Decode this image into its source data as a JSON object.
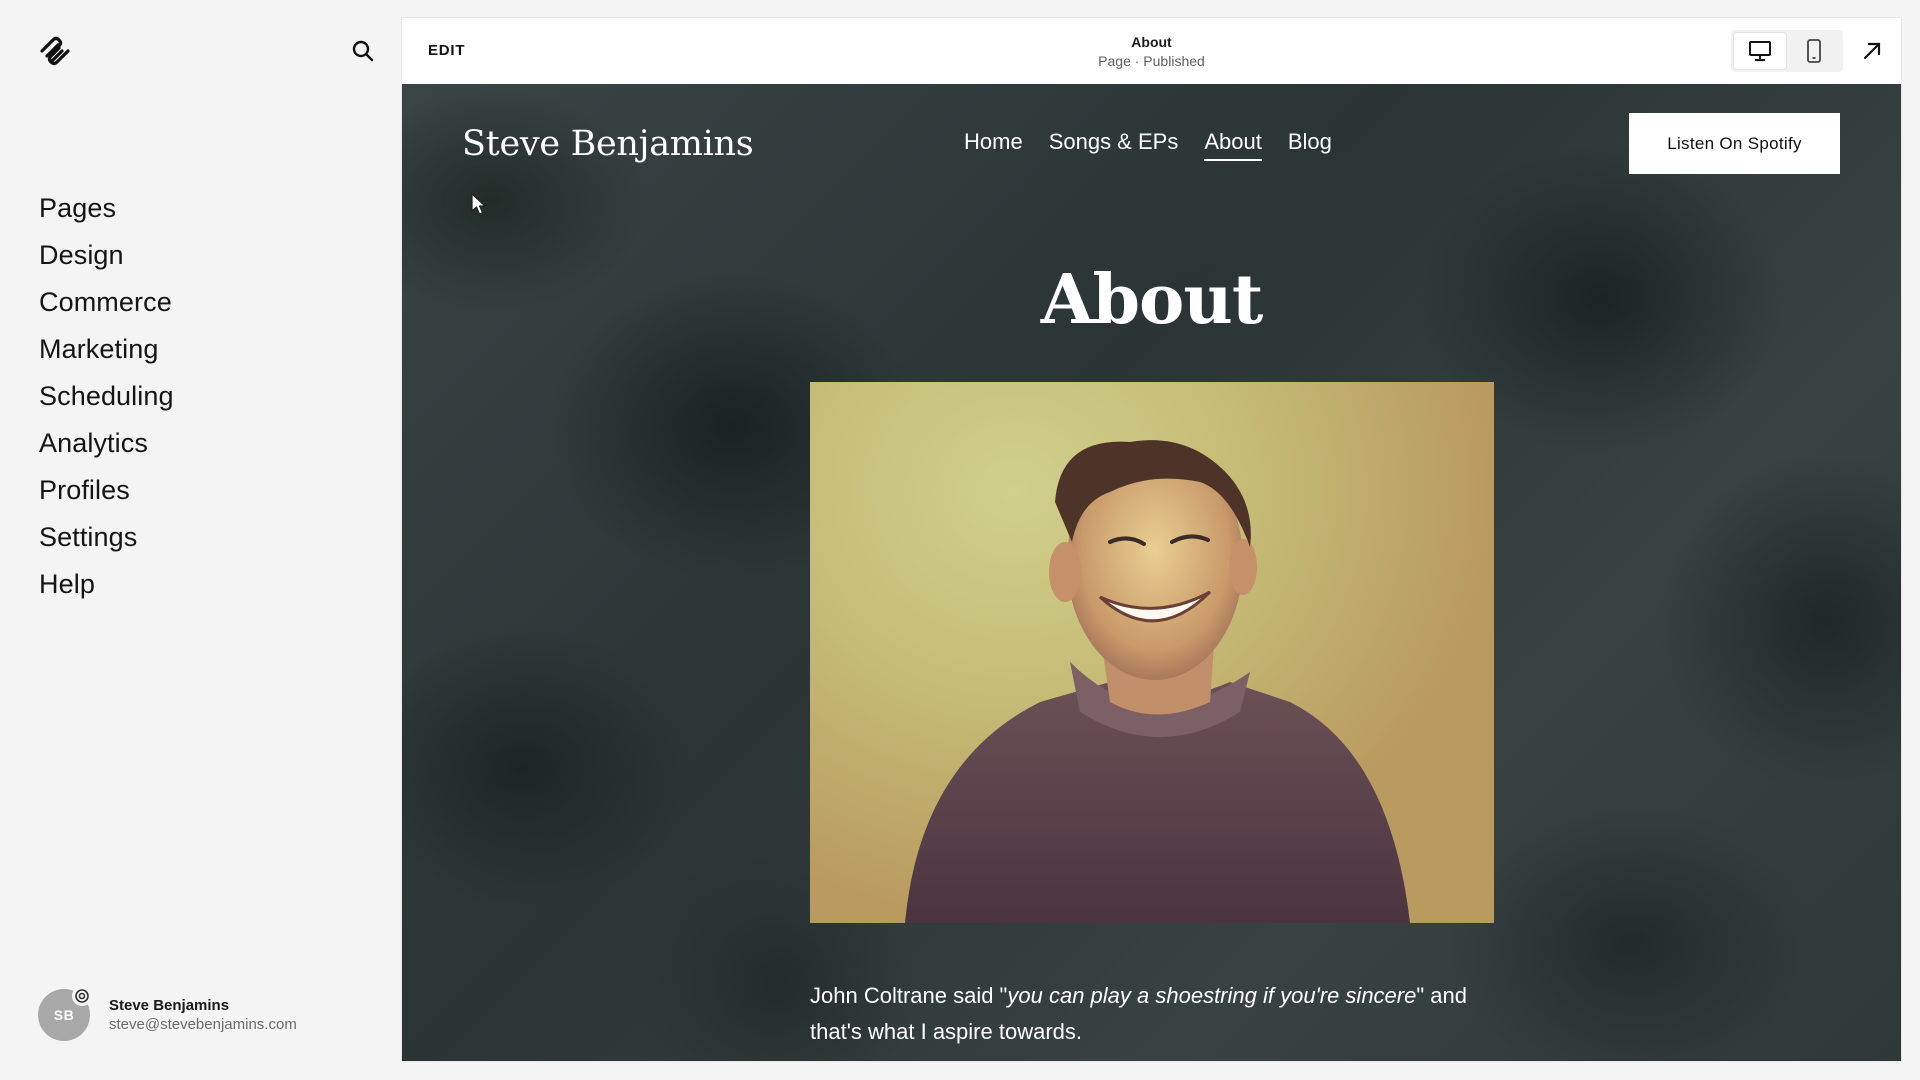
{
  "sidebar": {
    "nav": [
      "Pages",
      "Design",
      "Commerce",
      "Marketing",
      "Scheduling",
      "Analytics",
      "Profiles",
      "Settings",
      "Help"
    ],
    "account": {
      "initials": "SB",
      "name": "Steve Benjamins",
      "email": "steve@stevebenjamins.com"
    }
  },
  "editor": {
    "edit_label": "EDIT",
    "page_title": "About",
    "page_status": "Page · Published"
  },
  "site": {
    "title": "Steve Benjamins",
    "nav": [
      "Home",
      "Songs & EPs",
      "About",
      "Blog"
    ],
    "active_nav": "About",
    "cta_label": "Listen On Spotify",
    "heading": "About",
    "bio": {
      "before": "John Coltrane said \"",
      "quote": "you can play a shoestring if you're sincere",
      "after": "\" and that's what I aspire towards."
    }
  }
}
